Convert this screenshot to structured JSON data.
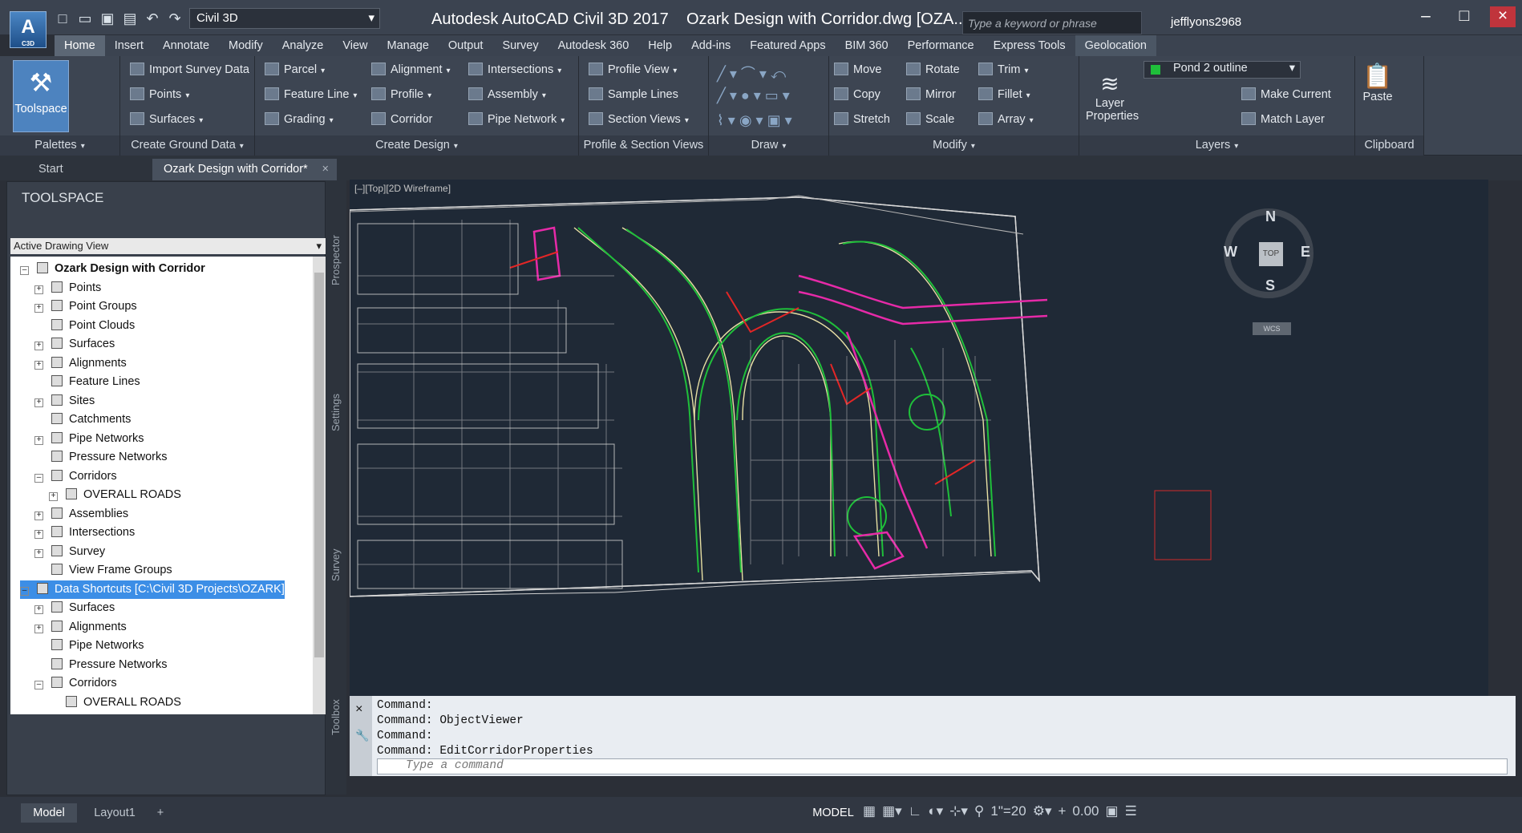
{
  "app": {
    "workspace": "Civil 3D",
    "title": "Autodesk AutoCAD Civil 3D 2017",
    "file": "Ozark Design with Corridor.dwg [OZA...",
    "search_placeholder": "Type a keyword or phrase",
    "user": "jefflyons2968"
  },
  "menu": [
    "Home",
    "Insert",
    "Annotate",
    "Modify",
    "Analyze",
    "View",
    "Manage",
    "Output",
    "Survey",
    "Autodesk 360",
    "Help",
    "Add-ins",
    "Featured Apps",
    "BIM 360",
    "Performance",
    "Express Tools",
    "Geolocation"
  ],
  "ribbon": {
    "palettes": {
      "title": "Palettes",
      "toolspace": "Toolspace"
    },
    "ground": {
      "title": "Create Ground Data",
      "items": [
        "Import Survey Data",
        "Points",
        "Surfaces"
      ]
    },
    "design": {
      "title": "Create Design",
      "items": [
        "Parcel",
        "Feature Line",
        "Grading",
        "Alignment",
        "Profile",
        "Corridor",
        "Intersections",
        "Assembly",
        "Pipe Network"
      ]
    },
    "profile": {
      "title": "Profile & Section Views",
      "items": [
        "Profile View",
        "Sample Lines",
        "Section Views"
      ]
    },
    "draw": {
      "title": "Draw"
    },
    "modify": {
      "title": "Modify",
      "items": [
        "Move",
        "Copy",
        "Stretch",
        "Rotate",
        "Mirror",
        "Scale",
        "Trim",
        "Fillet",
        "Array"
      ]
    },
    "layers": {
      "title": "Layers",
      "layer_name": "Pond 2 outline",
      "layer_properties": "Layer Properties",
      "make_current": "Make Current",
      "match_layer": "Match Layer"
    },
    "clipboard": {
      "title": "Clipboard",
      "paste": "Paste"
    }
  },
  "tabs": {
    "start": "Start",
    "doc": "Ozark Design with Corridor*"
  },
  "toolspace": {
    "title": "TOOLSPACE",
    "view": "Active Drawing View",
    "tree": [
      {
        "label": "Ozark Design with Corridor",
        "level": 0,
        "bold": true,
        "pm": "-"
      },
      {
        "label": "Points",
        "level": 1,
        "pm": "+"
      },
      {
        "label": "Point Groups",
        "level": 1,
        "pm": "+"
      },
      {
        "label": "Point Clouds",
        "level": 1,
        "pm": ""
      },
      {
        "label": "Surfaces",
        "level": 1,
        "pm": "+"
      },
      {
        "label": "Alignments",
        "level": 1,
        "pm": "+"
      },
      {
        "label": "Feature Lines",
        "level": 1,
        "pm": ""
      },
      {
        "label": "Sites",
        "level": 1,
        "pm": "+"
      },
      {
        "label": "Catchments",
        "level": 1,
        "pm": ""
      },
      {
        "label": "Pipe Networks",
        "level": 1,
        "pm": "+"
      },
      {
        "label": "Pressure Networks",
        "level": 1,
        "pm": ""
      },
      {
        "label": "Corridors",
        "level": 1,
        "pm": "-"
      },
      {
        "label": "OVERALL ROADS",
        "level": 2,
        "pm": "+"
      },
      {
        "label": "Assemblies",
        "level": 1,
        "pm": "+"
      },
      {
        "label": "Intersections",
        "level": 1,
        "pm": "+"
      },
      {
        "label": "Survey",
        "level": 1,
        "pm": "+"
      },
      {
        "label": "View Frame Groups",
        "level": 1,
        "pm": ""
      },
      {
        "label": "Data Shortcuts [C:\\Civil 3D Projects\\OZARK]",
        "level": 0,
        "pm": "-",
        "selected": true
      },
      {
        "label": "Surfaces",
        "level": 1,
        "pm": "+"
      },
      {
        "label": "Alignments",
        "level": 1,
        "pm": "+"
      },
      {
        "label": "Pipe Networks",
        "level": 1,
        "pm": ""
      },
      {
        "label": "Pressure Networks",
        "level": 1,
        "pm": ""
      },
      {
        "label": "Corridors",
        "level": 1,
        "pm": "-"
      },
      {
        "label": "OVERALL ROADS",
        "level": 2,
        "pm": ""
      }
    ],
    "vtabs": [
      "Prospector",
      "Settings",
      "Survey",
      "Toolbox"
    ]
  },
  "viewport": {
    "label": "[–][Top][2D Wireframe]",
    "compass": {
      "n": "N",
      "s": "S",
      "e": "E",
      "w": "W",
      "top": "TOP"
    },
    "wcs": "WCS"
  },
  "command": {
    "history": [
      "Command:",
      "Command: ObjectViewer",
      "Command:",
      "Command: EditCorridorProperties",
      "Command:"
    ],
    "placeholder": "Type a command"
  },
  "status": {
    "model_tab": "Model",
    "layout_tab": "Layout1",
    "model": "MODEL",
    "scale": "1\"=20",
    "value": "0.00"
  },
  "colors": {
    "accent": "#4d83bf",
    "selection": "#3c8ee6",
    "canvas": "#1f2936"
  }
}
